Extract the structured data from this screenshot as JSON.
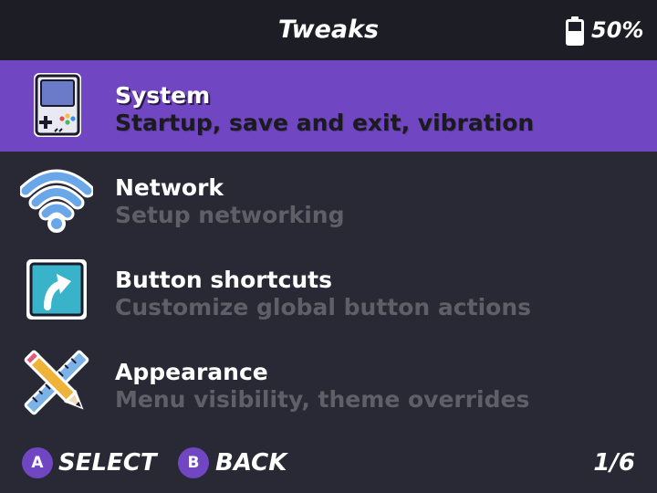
{
  "header": {
    "title": "Tweaks",
    "battery_level": "50%",
    "battery_icon": "battery-icon"
  },
  "menu": {
    "selected_index": 0,
    "items": [
      {
        "title": "System",
        "subtitle": "Startup, save and exit, vibration",
        "icon": "handheld-console-icon"
      },
      {
        "title": "Network",
        "subtitle": "Setup networking",
        "icon": "wifi-icon"
      },
      {
        "title": "Button shortcuts",
        "subtitle": "Customize global button actions",
        "icon": "shortcut-arrow-icon"
      },
      {
        "title": "Appearance",
        "subtitle": "Menu visibility, theme overrides",
        "icon": "pencil-ruler-icon"
      }
    ]
  },
  "footer": {
    "select_key": "A",
    "select_label": "SELECT",
    "back_key": "B",
    "back_label": "BACK",
    "page": "1/6"
  },
  "colors": {
    "accent": "#7046c2",
    "background": "#282934",
    "header_background": "#1d1e25",
    "subtitle": "#5f5f68"
  }
}
